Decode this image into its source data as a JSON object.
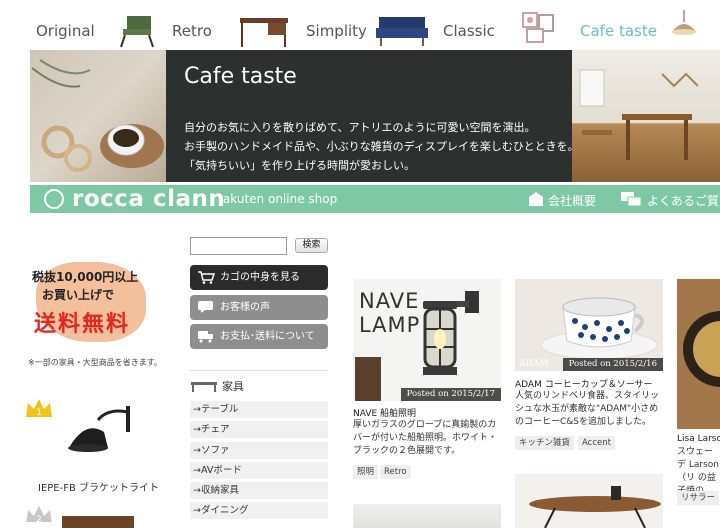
{
  "nav": {
    "tabs": [
      {
        "label": "Original"
      },
      {
        "label": "Retro"
      },
      {
        "label": "Simplity"
      },
      {
        "label": "Classic"
      },
      {
        "label": "Cafe taste"
      }
    ],
    "active_color": "#6bbfb9"
  },
  "hero": {
    "title": "Cafe taste",
    "lines": [
      "自分のお気に入りを散りばめて、アトリエのように可愛い空間を演出。",
      "お手製のハンドメイド品や、小ぶりな雑貨のディスプレイを楽しむひとときを。",
      "「気持ちいい」を作り上げる時間が愛おしい。"
    ]
  },
  "shopbar": {
    "logo": "rocca clann",
    "subtitle": "rakuten online shop",
    "links": [
      "会社概要",
      "よくあるご質問"
    ],
    "color": "#7ec8a6"
  },
  "promo": {
    "line1": "税抜10,000円以上",
    "line2": "お買い上げで",
    "line3": "送料無料",
    "note": "※一部の家具・大型商品を省きます。"
  },
  "ranking": {
    "rank1": "1",
    "rank2": "2",
    "item1": "IEPE-FB ブラケットライト"
  },
  "search": {
    "placeholder": "",
    "button": "検索"
  },
  "sidebar": {
    "cart": "カゴの中身を見る",
    "reviews": "お客様の声",
    "payment": "お支払･送料について",
    "category": "家具",
    "items": [
      "→テーブル",
      "→チェア",
      "→ソファ",
      "→AVボード",
      "→収納家具",
      "→ダイニング"
    ]
  },
  "products": [
    {
      "image_text_1": "NAVE",
      "image_text_2": "LAMP",
      "posted": "Posted on 2015/2/17",
      "title": "NAVE 船舶照明",
      "desc": "厚いガラスのグローブに真鍮製のカバーが付いた船舶照明。ホワイト・ブラックの２色展開です。",
      "tags": [
        "照明",
        "Retro"
      ]
    },
    {
      "image_text_1": "ADAM",
      "posted": "Posted on 2015/2/16",
      "title": "ADAM コーヒーカップ＆ソーサー",
      "desc": "人気のリンドベリ食器、スタイリッシュな水玉が素敵な\"ADAM\"小さめのコーヒーC&Sを追加しました。",
      "tags": [
        "キッチン雑貨",
        "Accent"
      ]
    },
    {
      "title": "Lisa Larso",
      "desc": "スウェーデ Larson（リ の益子焼の",
      "tags": [
        "リサラー"
      ]
    }
  ]
}
